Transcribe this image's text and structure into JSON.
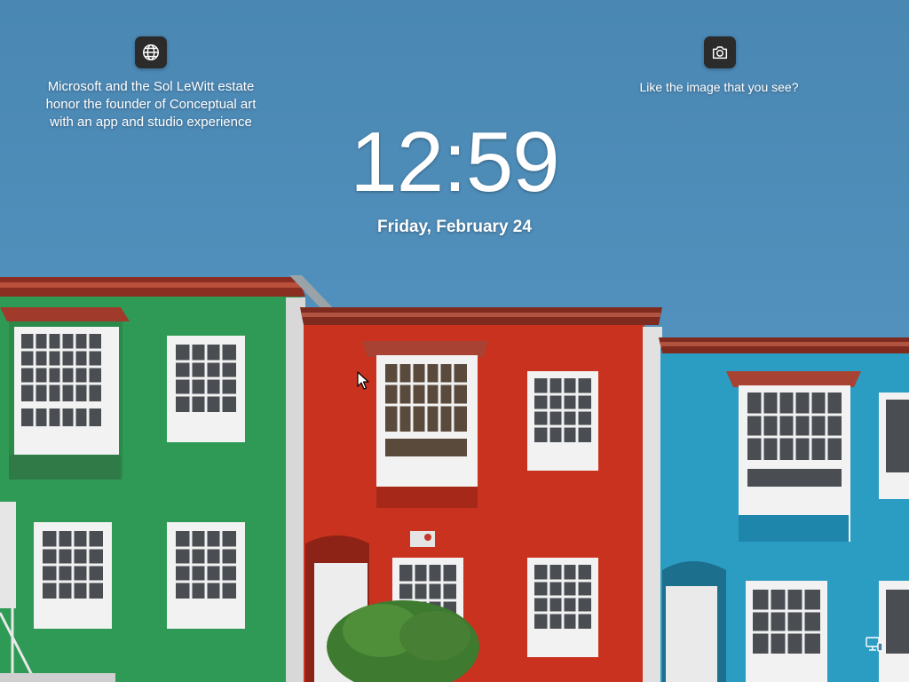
{
  "lock_screen": {
    "spotlight_info": {
      "icon": "globe-icon",
      "text": "Microsoft and the Sol LeWitt estate honor the founder of Conceptual art with an app and studio experience"
    },
    "like_image": {
      "icon": "camera-icon",
      "text": "Like the image that you see?"
    },
    "clock": {
      "time": "12:59"
    },
    "date": {
      "text": "Friday, February 24"
    },
    "status": {
      "network_icon": "network-monitor-icon"
    }
  },
  "colors": {
    "sky": "#4f8fbd",
    "green_house": "#2f9a55",
    "red_house": "#c8321f",
    "blue_house": "#2b9cc2",
    "icon_bg": "#2b2b2b"
  }
}
